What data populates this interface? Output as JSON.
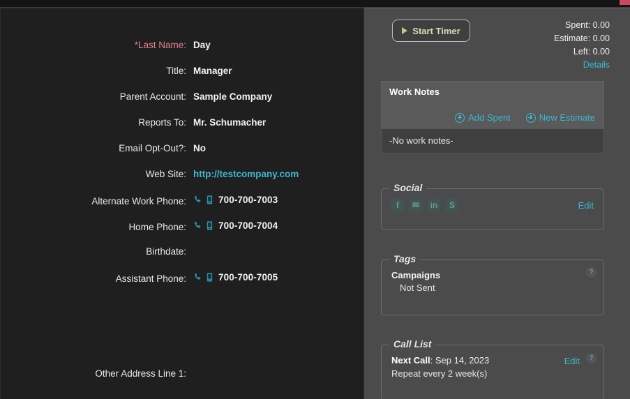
{
  "window": {
    "close_button": "close-window"
  },
  "contact_details": {
    "fields": [
      {
        "label": "*Last Name:",
        "value": "Day",
        "type": "text",
        "required": true
      },
      {
        "label": "Title:",
        "value": "Manager",
        "type": "text",
        "required": false
      },
      {
        "label": "Parent Account:",
        "value": "Sample Company",
        "type": "text",
        "required": false
      },
      {
        "label": "Reports To:",
        "value": "Mr. Schumacher",
        "type": "text",
        "required": false
      },
      {
        "label": "Email Opt-Out?:",
        "value": "No",
        "type": "text",
        "required": false
      },
      {
        "label": "Web Site:",
        "value": "http://testcompany.com",
        "type": "link",
        "required": false
      },
      {
        "label": "Alternate Work Phone:",
        "value": "700-700-7003",
        "type": "phone",
        "required": false
      },
      {
        "label": "Home Phone:",
        "value": "700-700-7004",
        "type": "phone",
        "required": false
      },
      {
        "label": "Birthdate:",
        "value": "",
        "type": "text",
        "required": false
      },
      {
        "label": "Assistant Phone:",
        "value": "700-700-7005",
        "type": "phone",
        "required": false
      }
    ],
    "other_address_label": "Other Address Line 1:",
    "other_address_value": ""
  },
  "timer": {
    "start_button": "Start Timer",
    "spent_label": "Spent:",
    "spent_value": "0.00",
    "estimate_label": "Estimate:",
    "estimate_value": "0.00",
    "left_label": "Left:",
    "left_value": "0.00",
    "details_link": "Details"
  },
  "work_notes": {
    "title": "Work Notes",
    "add_spent": "Add Spent",
    "new_estimate": "New Estimate",
    "empty_text": "-No work notes-"
  },
  "social": {
    "legend": "Social",
    "edit_label": "Edit",
    "icons": [
      {
        "name": "facebook-icon",
        "glyph": "f"
      },
      {
        "name": "twitter-icon",
        "glyph": "✉"
      },
      {
        "name": "linkedin-icon",
        "glyph": "in"
      },
      {
        "name": "skype-icon",
        "glyph": "S"
      }
    ]
  },
  "tags": {
    "legend": "Tags",
    "name": "Campaigns",
    "value": "Not Sent",
    "help_glyph": "?"
  },
  "call_list": {
    "legend": "Call List",
    "next_call_label": "Next Call",
    "next_call_value": "Sep 14, 2023",
    "repeat_text": "Repeat every 2 week(s)",
    "edit_label": "Edit",
    "help_glyph": "?"
  },
  "colors": {
    "accent_link": "#3ab7d0",
    "required_label": "#e8808f",
    "timer_green": "#cfe0b4",
    "close_red": "#c8495f"
  }
}
